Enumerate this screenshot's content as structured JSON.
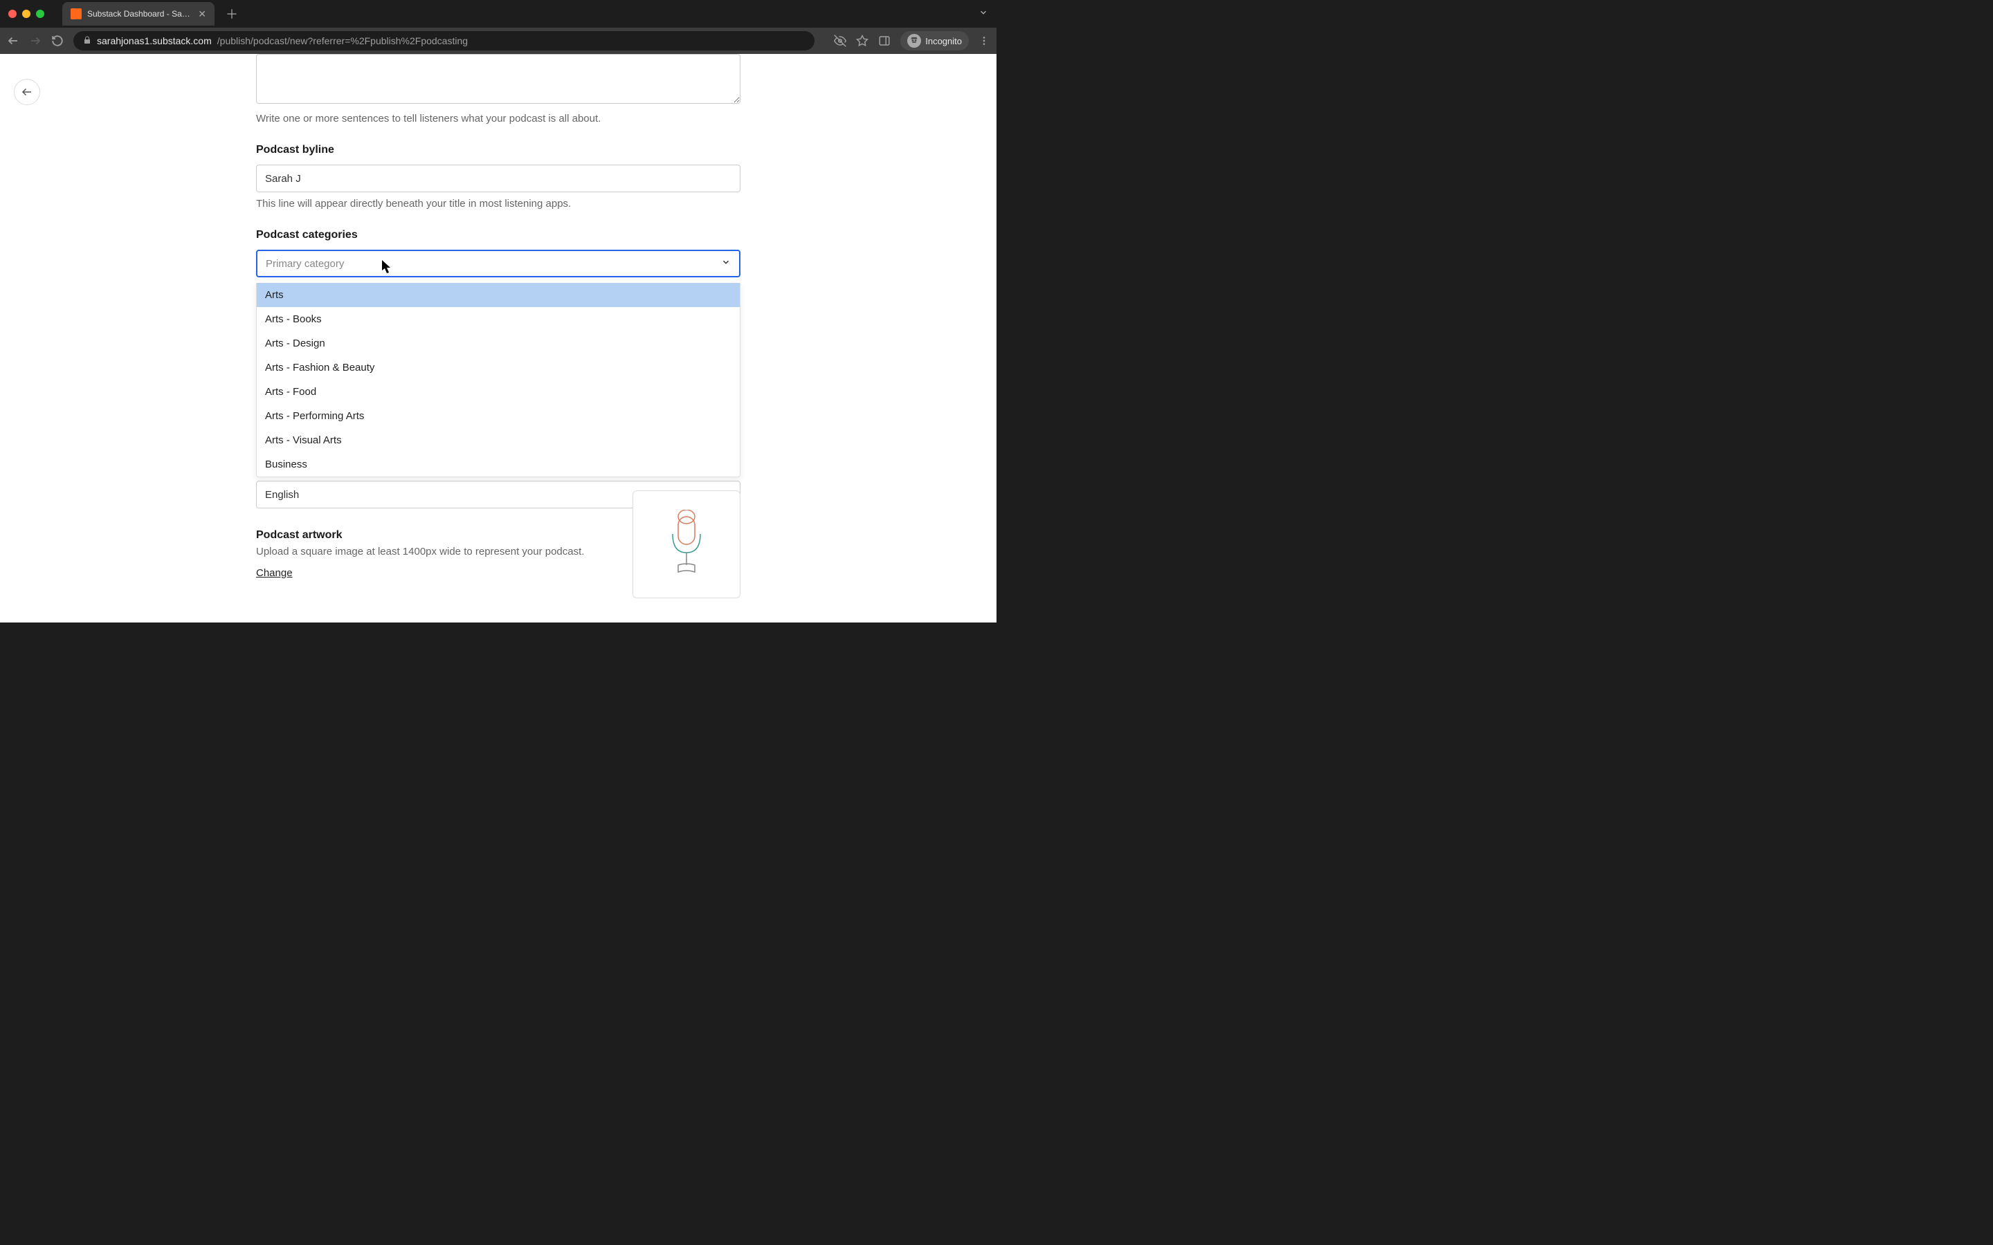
{
  "browser": {
    "tab_title": "Substack Dashboard - Sarah's",
    "url_host": "sarahjonas1.substack.com",
    "url_path": "/publish/podcast/new?referrer=%2Fpublish%2Fpodcasting",
    "incognito_label": "Incognito"
  },
  "form": {
    "description_helper": "Write one or more sentences to tell listeners what your podcast is all about.",
    "byline_label": "Podcast byline",
    "byline_value": "Sarah J",
    "byline_helper": "This line will appear directly beneath your title in most listening apps.",
    "categories_label": "Podcast categories",
    "primary_placeholder": "Primary category",
    "category_options": [
      "Arts",
      "Arts - Books",
      "Arts - Design",
      "Arts - Fashion & Beauty",
      "Arts - Food",
      "Arts - Performing Arts",
      "Arts - Visual Arts",
      "Business"
    ],
    "language_value": "English",
    "artwork_label": "Podcast artwork",
    "artwork_helper": "Upload a square image at least 1400px wide to represent your podcast.",
    "change_link": "Change"
  }
}
